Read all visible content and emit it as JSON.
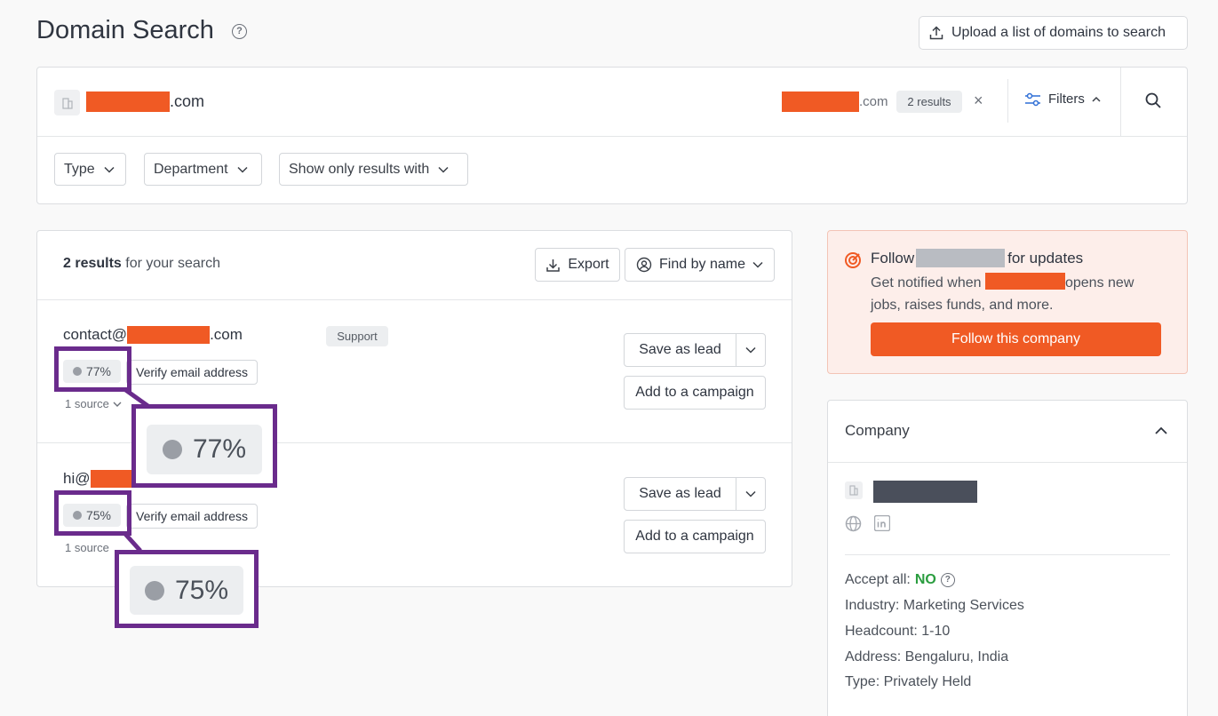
{
  "header": {
    "title": "Domain Search",
    "upload_label": "Upload a list of domains to search"
  },
  "search": {
    "domain_suffix": ".com",
    "chip_suffix": ".com",
    "results_chip": "2 results",
    "close_glyph": "×",
    "filters_label": "Filters"
  },
  "filters": {
    "type_label": "Type",
    "department_label": "Department",
    "show_only_label": "Show only results with"
  },
  "results": {
    "count_bold": "2 results",
    "count_rest": " for your search",
    "export_label": "Export",
    "find_by_name_label": "Find by name",
    "items": [
      {
        "email_prefix": "contact@",
        "email_suffix": ".com",
        "department": "Support",
        "score": "77%",
        "verify_label": "Verify email address",
        "source": "1 source",
        "save_label": "Save as lead",
        "campaign_label": "Add to a campaign"
      },
      {
        "email_prefix": "hi@",
        "score": "75%",
        "verify_label": "Verify email address",
        "source": "1 source",
        "save_label": "Save as lead",
        "campaign_label": "Add to a campaign"
      }
    ]
  },
  "zoom": {
    "first": "77%",
    "second": "75%"
  },
  "follow": {
    "title_prefix": "Follow",
    "title_suffix": "for updates",
    "desc_prefix": "Get notified when",
    "desc_suffix": "opens new jobs, raises funds, and more.",
    "button_label": "Follow this company"
  },
  "company": {
    "title": "Company",
    "accept_all_label": "Accept all:",
    "accept_all_value": "NO",
    "industry": "Industry: Marketing Services",
    "headcount": "Headcount: 1-10",
    "address": "Address: Bengaluru, India",
    "type": "Type: Privately Held"
  },
  "colors": {
    "accent_orange": "#f05a24",
    "highlight_purple": "#6a2b8c",
    "positive_green": "#2a9d3f"
  }
}
